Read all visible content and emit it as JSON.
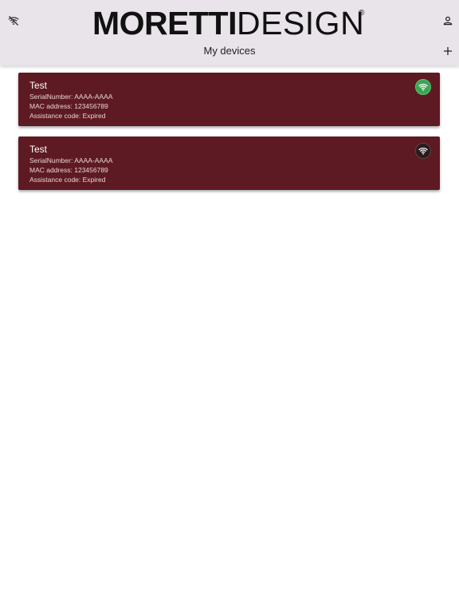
{
  "header": {
    "logo": {
      "bold_part": "MORETTI",
      "light_part": "DESIGN",
      "registered_mark": "®"
    },
    "title": "My devices",
    "left_icon": "wifi-off-icon",
    "right_icon": "account-icon",
    "action_icon": "add-icon"
  },
  "devices": [
    {
      "name": "Test",
      "serial_label": "SerialNumber:",
      "serial_value": "AAAA-AAAA",
      "mac_label": "MAC address:",
      "mac_value": "123456789",
      "assist_label": "Assistance code:",
      "assist_value": "Expired",
      "status": "online",
      "status_color": "#3aa655",
      "status_icon": "wifi-icon"
    },
    {
      "name": "Test",
      "serial_label": "SerialNumber:",
      "serial_value": "AAAA-AAAA",
      "mac_label": "MAC address:",
      "mac_value": "123456789",
      "assist_label": "Assistance code:",
      "assist_value": "Expired",
      "status": "offline",
      "status_color": "#2a1b1d",
      "status_icon": "wifi-icon"
    }
  ],
  "colors": {
    "header_bg": "#e9e3ea",
    "card_bg": "#5e1a22",
    "page_bg": "#ffffff"
  }
}
